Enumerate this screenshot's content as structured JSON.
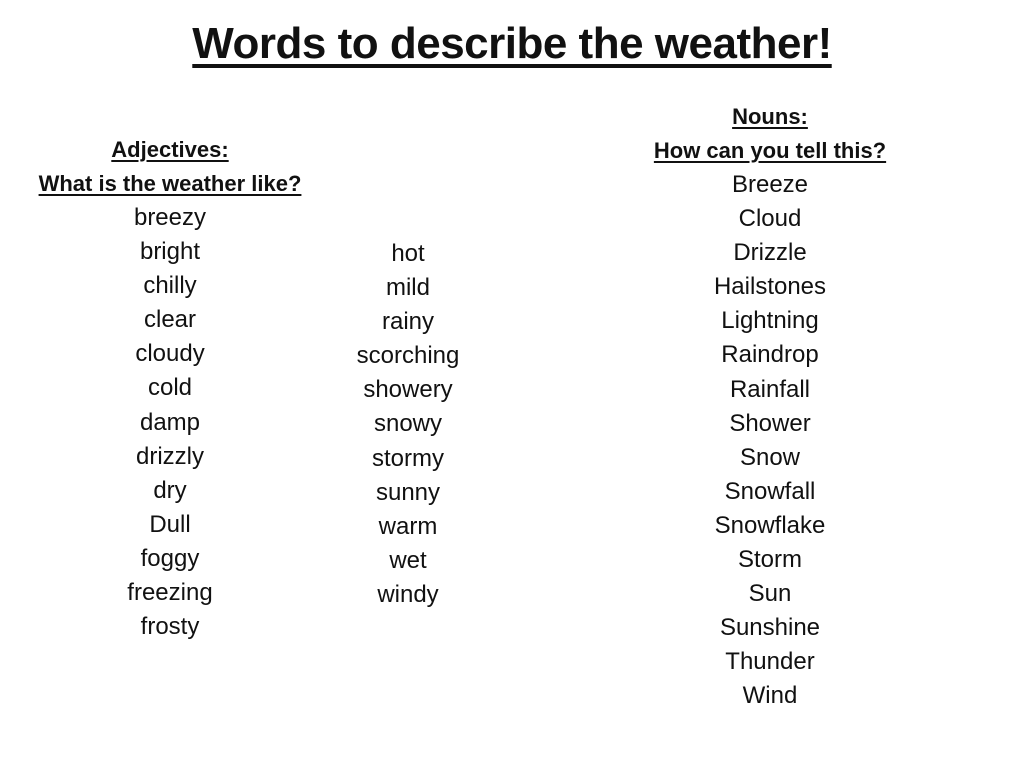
{
  "title": "Words to describe the weather!",
  "adjectives": {
    "heading": "Adjectives:",
    "subheading": "What is the weather like?",
    "column1": [
      "breezy",
      "bright",
      "chilly",
      "clear",
      "cloudy",
      "cold",
      "damp",
      "drizzly",
      "dry",
      "Dull",
      "foggy",
      "freezing",
      "frosty"
    ],
    "column2": [
      "hot",
      "mild",
      "rainy",
      "scorching",
      "showery",
      "snowy",
      "stormy",
      "sunny",
      "warm",
      "wet",
      "windy"
    ]
  },
  "nouns": {
    "heading": "Nouns:",
    "subheading": "How can you tell this?",
    "items": [
      "Breeze",
      "Cloud",
      "Drizzle",
      "Hailstones",
      "Lightning",
      "Raindrop",
      "Rainfall",
      "Shower",
      "Snow",
      "Snowfall",
      "Snowflake",
      "Storm",
      "Sun",
      "Sunshine",
      "Thunder",
      "Wind"
    ]
  }
}
